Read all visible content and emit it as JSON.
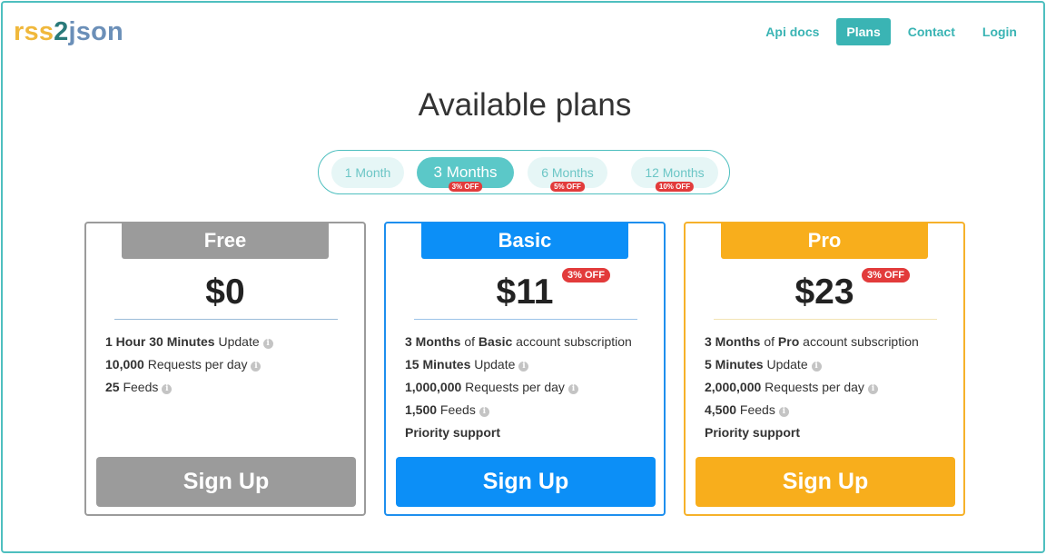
{
  "logo": {
    "part1": "rss",
    "part2": "2",
    "part3": "json"
  },
  "nav": {
    "api_docs": "Api docs",
    "plans": "Plans",
    "contact": "Contact",
    "login": "Login"
  },
  "page_title": "Available plans",
  "periods": [
    {
      "label": "1 Month",
      "badge": "",
      "active": false
    },
    {
      "label": "3 Months",
      "badge": "3% OFF",
      "active": true
    },
    {
      "label": "6 Months",
      "badge": "5% OFF",
      "active": false
    },
    {
      "label": "12 Months",
      "badge": "10% OFF",
      "active": false
    }
  ],
  "plans": {
    "free": {
      "name": "Free",
      "price": "$0",
      "features": [
        {
          "bold": "1 Hour 30 Minutes",
          "mid": "",
          "bold2": "",
          "rest": " Update",
          "info": true
        },
        {
          "bold": "10,000",
          "mid": "",
          "bold2": "",
          "rest": " Requests per day",
          "info": true
        },
        {
          "bold": "25",
          "mid": "",
          "bold2": "",
          "rest": " Feeds",
          "info": true
        }
      ],
      "signup": "Sign Up"
    },
    "basic": {
      "name": "Basic",
      "price": "$11",
      "badge": "3% OFF",
      "features": [
        {
          "bold": "3 Months",
          "mid": " of ",
          "bold2": "Basic",
          "rest": " account subscription",
          "info": false
        },
        {
          "bold": "15 Minutes",
          "mid": "",
          "bold2": "",
          "rest": " Update",
          "info": true
        },
        {
          "bold": "1,000,000",
          "mid": "",
          "bold2": "",
          "rest": " Requests per day",
          "info": true
        },
        {
          "bold": "1,500",
          "mid": "",
          "bold2": "",
          "rest": " Feeds",
          "info": true
        },
        {
          "bold": "Priority support",
          "mid": "",
          "bold2": "",
          "rest": "",
          "info": false
        }
      ],
      "signup": "Sign Up"
    },
    "pro": {
      "name": "Pro",
      "price": "$23",
      "badge": "3% OFF",
      "features": [
        {
          "bold": "3 Months",
          "mid": " of ",
          "bold2": "Pro",
          "rest": " account subscription",
          "info": false
        },
        {
          "bold": "5 Minutes",
          "mid": "",
          "bold2": "",
          "rest": " Update",
          "info": true
        },
        {
          "bold": "2,000,000",
          "mid": "",
          "bold2": "",
          "rest": " Requests per day",
          "info": true
        },
        {
          "bold": "4,500",
          "mid": "",
          "bold2": "",
          "rest": " Feeds",
          "info": true
        },
        {
          "bold": "Priority support",
          "mid": "",
          "bold2": "",
          "rest": "",
          "info": false
        }
      ],
      "signup": "Sign Up"
    }
  },
  "colors": {
    "accent": "#3ab4b4",
    "free": "#9b9b9b",
    "basic": "#0c8ff7",
    "pro": "#f8ae1c",
    "badge": "#e23b3b"
  },
  "icons": {
    "info": "info-circle-icon"
  }
}
